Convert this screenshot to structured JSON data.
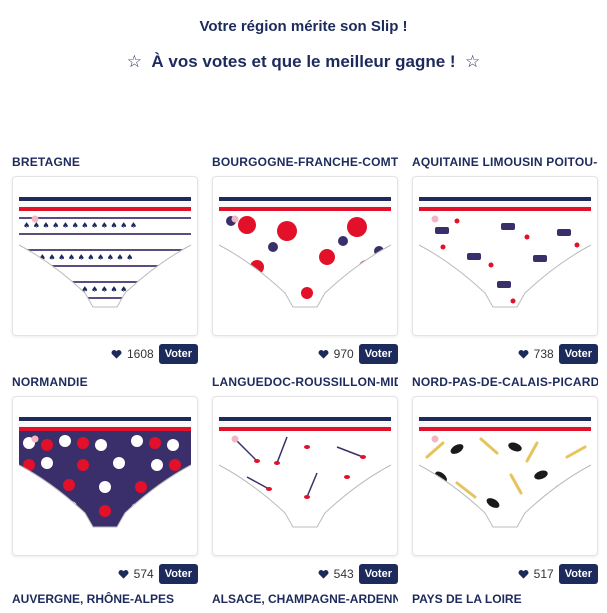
{
  "header": {
    "title": "Votre région mérite son Slip !",
    "subtitle_star_left": "☆",
    "subtitle_text": "À vos votes et que le meilleur gagne !",
    "subtitle_star_right": "☆"
  },
  "cards": [
    {
      "region": "BRETAGNE",
      "votes": "1608",
      "vote_label": "Voter",
      "pattern": "bretagne"
    },
    {
      "region": "BOURGOGNE-FRANCHE-COMTÉ",
      "votes": "970",
      "vote_label": "Voter",
      "pattern": "bourgogne"
    },
    {
      "region": "AQUITAINE LIMOUSIN POITOU-CHARENTES",
      "votes": "738",
      "vote_label": "Voter",
      "pattern": "aquitaine"
    },
    {
      "region": "NORMANDIE",
      "votes": "574",
      "vote_label": "Voter",
      "pattern": "normandie"
    },
    {
      "region": "LANGUEDOC-ROUSSILLON-MIDI-PYRÉNÉES",
      "votes": "543",
      "vote_label": "Voter",
      "pattern": "languedoc"
    },
    {
      "region": "NORD-PAS-DE-CALAIS-PICARDIE",
      "votes": "517",
      "vote_label": "Voter",
      "pattern": "nord"
    }
  ],
  "next_row_regions": [
    "AUVERGNE, RHÔNE-ALPES",
    "ALSACE, CHAMPAGNE-ARDENNE, LORRAINE",
    "PAYS DE LA LOIRE"
  ],
  "colors": {
    "navy": "#1d2a5c",
    "red": "#e3102a",
    "white": "#ffffff"
  }
}
